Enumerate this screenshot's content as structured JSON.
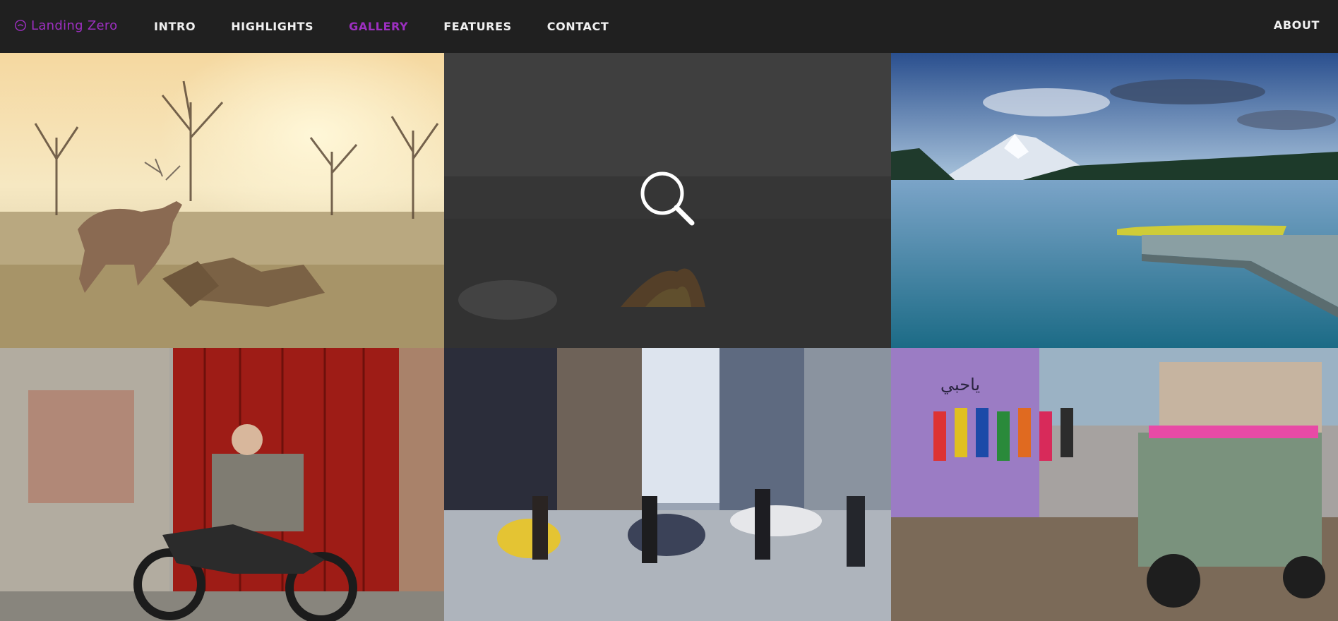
{
  "header": {
    "brand": "Landing Zero",
    "nav": [
      {
        "label": "INTRO",
        "active": false
      },
      {
        "label": "HIGHLIGHTS",
        "active": false
      },
      {
        "label": "GALLERY",
        "active": true
      },
      {
        "label": "FEATURES",
        "active": false
      },
      {
        "label": "CONTACT",
        "active": false
      }
    ],
    "about": "ABOUT",
    "accent_color": "#9d2fc1"
  },
  "gallery": {
    "items": [
      {
        "icon": "deer-photo"
      },
      {
        "icon": "beach-campfire-photo",
        "hovered": true
      },
      {
        "icon": "mountain-lake-dock-photo"
      },
      {
        "icon": "motorcycle-red-door-photo"
      },
      {
        "icon": "city-street-crosswalk-photo"
      },
      {
        "icon": "market-tuk-tuk-photo"
      }
    ],
    "sign_text": "ياحبي"
  }
}
